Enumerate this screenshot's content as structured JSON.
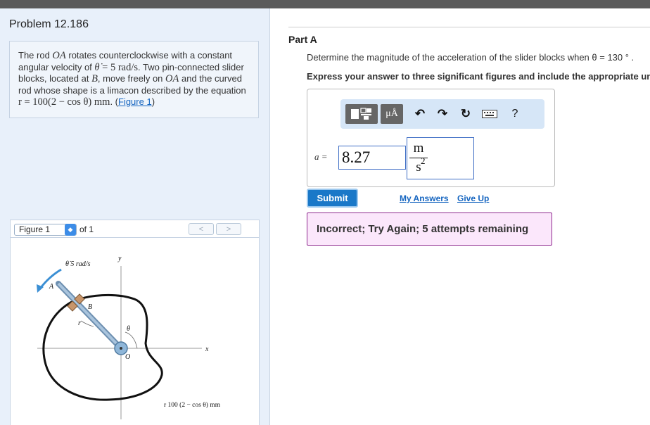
{
  "problem": {
    "title": "Problem 12.186",
    "desc_p1": "The rod ",
    "rod": "OA",
    "desc_p2": " rotates counterclockwise with a constant angular velocity of ",
    "theta_dot_sym": "θ̇",
    "eq": " = 5 rad/s",
    "desc_p3": ". Two pin-connected slider blocks, located at ",
    "B": "B",
    "desc_p4": ", move freely on ",
    "desc_p5": " and the curved rod whose shape is a limacon described by the equation ",
    "equation": "r = 100(2 − cos θ) mm",
    "desc_p6": ". (",
    "fig_link": "Figure 1",
    "desc_p7": ")"
  },
  "figure_nav": {
    "selected": "Figure 1",
    "of": "of 1",
    "prev": "<",
    "next": ">"
  },
  "figure": {
    "omega_label": "θ̇  5 rad/s",
    "y_label": "y",
    "x_label": "x",
    "A_label": "A",
    "B_label": "B",
    "r_label": "r",
    "theta_label": "θ",
    "O_label": "O",
    "eq_label": "r  100 (2 − cos θ) mm"
  },
  "part": {
    "label": "Part A",
    "question": "Determine the magnitude of the acceleration of the slider blocks when θ = 130 ° .",
    "instruction": "Express your answer to three significant figures and include the appropriate units."
  },
  "toolbar": {
    "mu": "μÅ",
    "help": "?"
  },
  "answer": {
    "var": "a =",
    "value": "8.27",
    "unit_num": "m",
    "unit_den": "s",
    "unit_exp": "2"
  },
  "actions": {
    "submit": "Submit",
    "my_answers": "My Answers",
    "give_up": "Give Up"
  },
  "feedback": "Incorrect; Try Again; 5 attempts remaining"
}
